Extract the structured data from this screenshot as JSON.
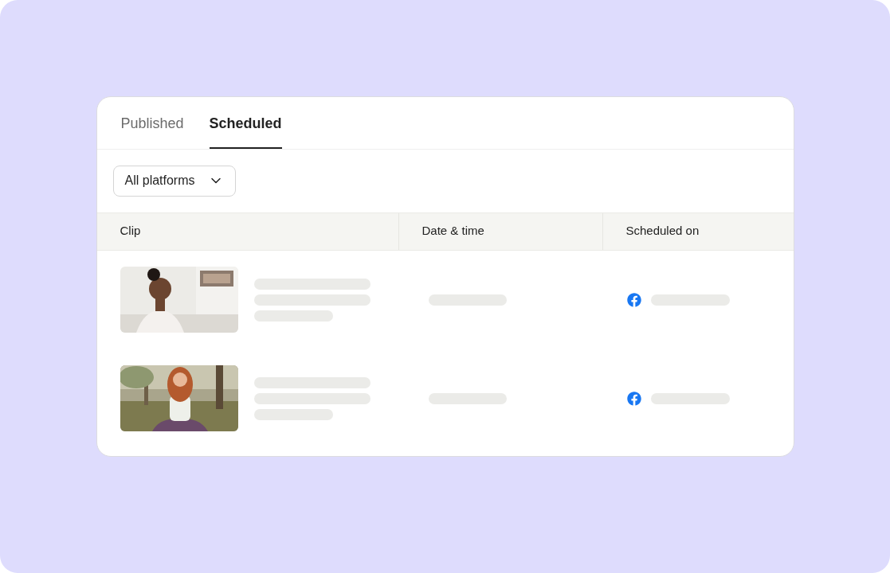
{
  "tabs": [
    {
      "label": "Published",
      "selected": false
    },
    {
      "label": "Scheduled",
      "selected": true
    }
  ],
  "filter": {
    "value": "All platforms"
  },
  "table": {
    "columns": [
      "Clip",
      "Date & time",
      "Scheduled on"
    ]
  }
}
